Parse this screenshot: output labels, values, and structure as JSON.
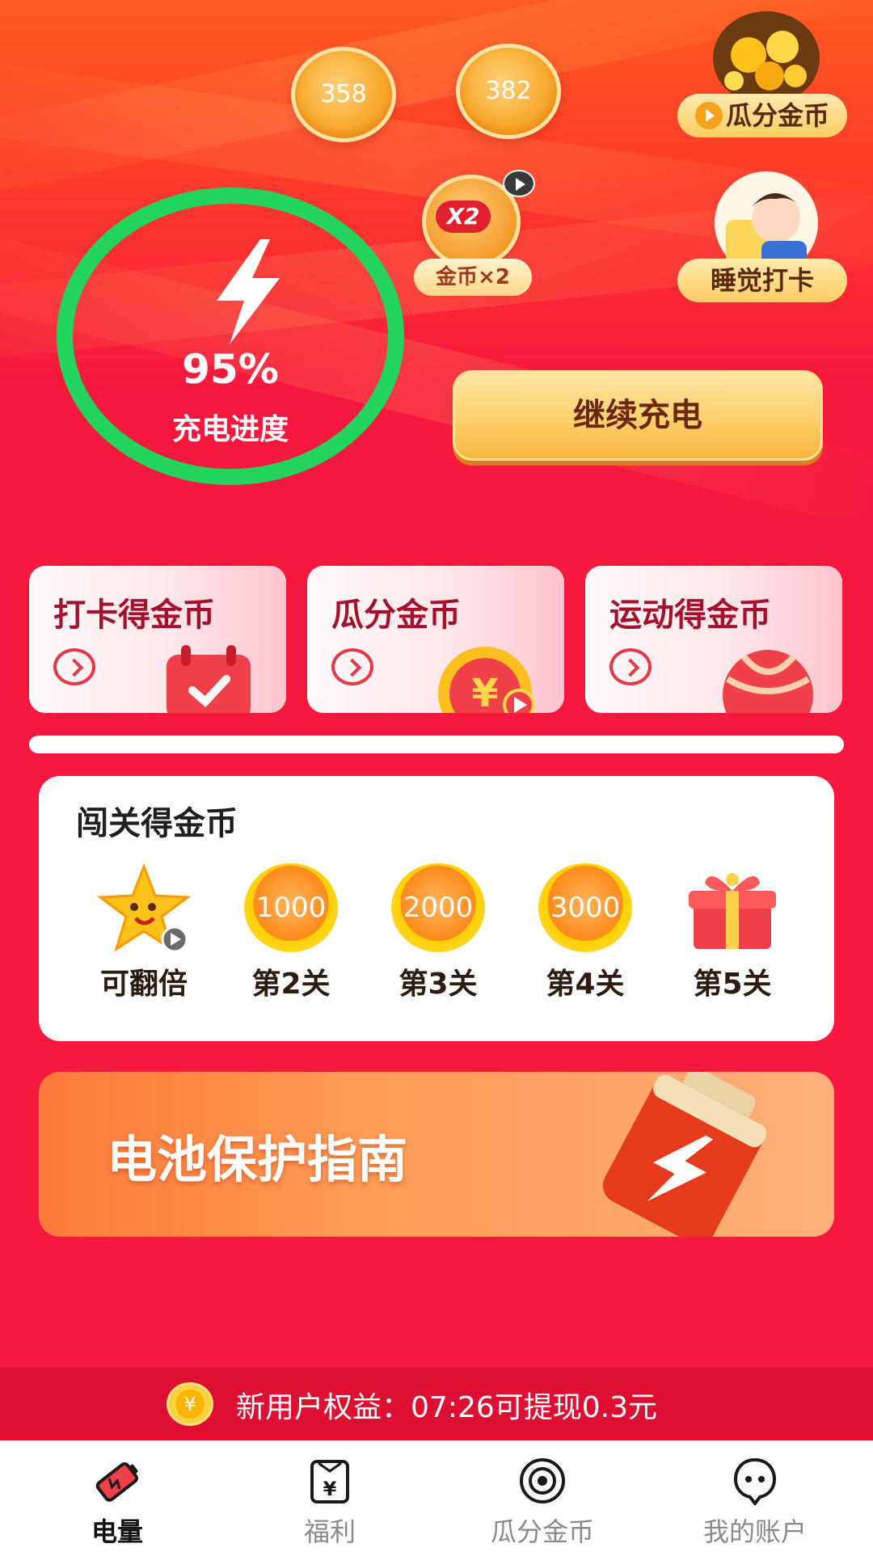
{
  "top_coins": [
    {
      "value": "358"
    },
    {
      "value": "382"
    }
  ],
  "double_coin": {
    "badge": "X2",
    "label": "金币×2"
  },
  "side_buttons": {
    "split_coins": "瓜分金币",
    "sleep_checkin": "睡觉打卡"
  },
  "charge": {
    "percent": "95%",
    "label": "充电进度",
    "progress": 0.95,
    "ring_color": "#22d45b"
  },
  "continue_button": "继续充电",
  "task_cards": [
    {
      "title": "打卡得金币",
      "icon": "calendar-check-icon"
    },
    {
      "title": "瓜分金币",
      "icon": "yuan-coin-icon"
    },
    {
      "title": "运动得金币",
      "icon": "ball-icon"
    }
  ],
  "levels": {
    "title": "闯关得金币",
    "items": [
      {
        "value": "",
        "label": "可翻倍",
        "icon": "star-icon"
      },
      {
        "value": "1000",
        "label": "第2关",
        "icon": "coin-icon"
      },
      {
        "value": "2000",
        "label": "第3关",
        "icon": "coin-icon"
      },
      {
        "value": "3000",
        "label": "第4关",
        "icon": "coin-icon"
      },
      {
        "value": "",
        "label": "第5关",
        "icon": "gift-icon"
      }
    ]
  },
  "banner": {
    "title": "电池保护指南"
  },
  "notice": {
    "coin_symbol": "¥",
    "text": "新用户权益：07:26可提现0.3元"
  },
  "tabbar": {
    "items": [
      {
        "label": "电量",
        "icon": "battery-icon",
        "active": true
      },
      {
        "label": "福利",
        "icon": "yuan-bag-icon",
        "active": false
      },
      {
        "label": "瓜分金币",
        "icon": "target-icon",
        "active": false
      },
      {
        "label": "我的账户",
        "icon": "user-face-icon",
        "active": false
      }
    ]
  },
  "colors": {
    "background": "#f7183e",
    "accent_gold": "#ffd06c",
    "card_text": "#a5102d"
  }
}
